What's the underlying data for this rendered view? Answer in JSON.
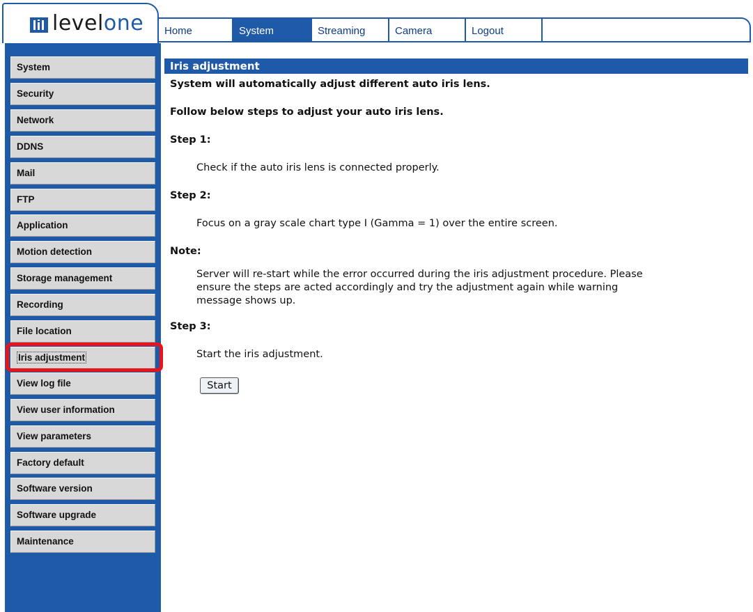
{
  "brand": {
    "logo_part1": "level",
    "logo_part2": "one"
  },
  "nav": {
    "tabs": [
      {
        "label": "Home"
      },
      {
        "label": "System",
        "active": true
      },
      {
        "label": "Streaming"
      },
      {
        "label": "Camera"
      },
      {
        "label": "Logout"
      }
    ]
  },
  "sidebar": {
    "items": [
      {
        "label": "System"
      },
      {
        "label": "Security"
      },
      {
        "label": "Network"
      },
      {
        "label": "DDNS"
      },
      {
        "label": "Mail"
      },
      {
        "label": "FTP"
      },
      {
        "label": "Application"
      },
      {
        "label": "Motion detection"
      },
      {
        "label": "Storage management"
      },
      {
        "label": "Recording"
      },
      {
        "label": "File location"
      },
      {
        "label": "Iris adjustment",
        "current": true
      },
      {
        "label": "View log file"
      },
      {
        "label": "View user information"
      },
      {
        "label": "View parameters"
      },
      {
        "label": "Factory default"
      },
      {
        "label": "Software version"
      },
      {
        "label": "Software upgrade"
      },
      {
        "label": "Maintenance"
      }
    ]
  },
  "main": {
    "title": "Iris adjustment",
    "intro": "System will automatically adjust different auto iris lens.",
    "follow": "Follow below steps to adjust your auto iris lens.",
    "step1_title": "Step 1:",
    "step1_text": "Check if the auto iris lens is connected properly.",
    "step2_title": "Step 2:",
    "step2_text": "Focus on a gray scale chart type I (Gamma = 1) over the entire screen.",
    "note_title": "Note:",
    "note_line1": "Server will re-start while the error occurred during the iris adjustment procedure. Please",
    "note_line2": "ensure the steps are acted accordingly and try the adjustment again while warning",
    "note_line3": "message shows up.",
    "step3_title": "Step 3:",
    "step3_text": "Start the iris adjustment.",
    "start_label": "Start"
  },
  "colors": {
    "accent": "#1f5aa8",
    "highlight": "#e8141b",
    "sidebar_item_bg": "#d8d8d8"
  }
}
